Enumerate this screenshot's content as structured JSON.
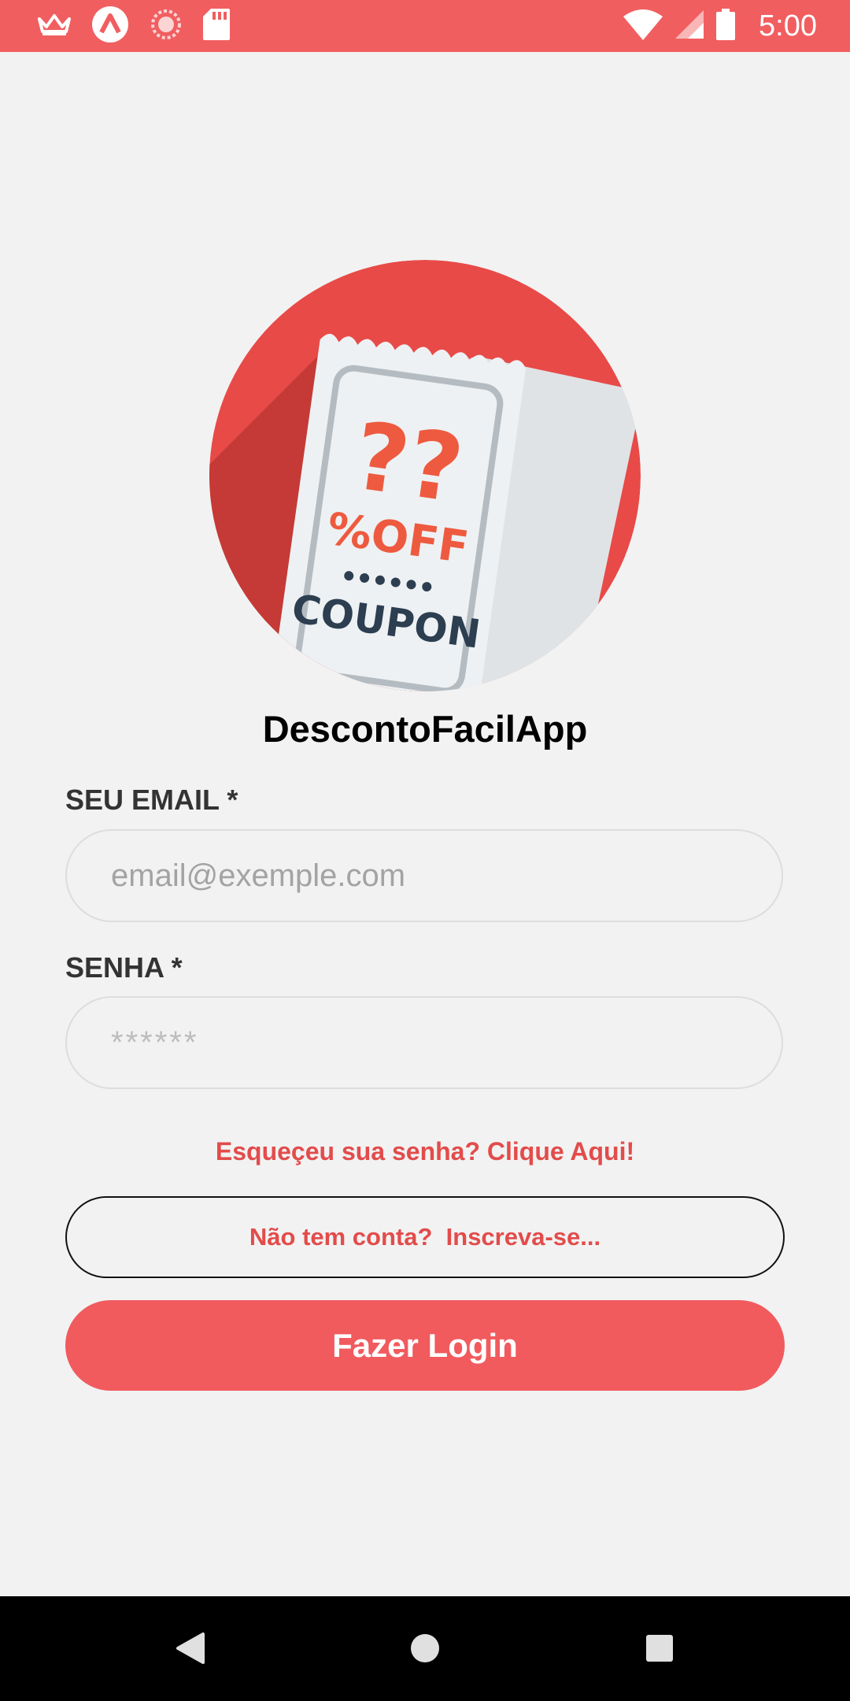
{
  "status_bar": {
    "time": "5:00",
    "icons_left": [
      "crown-icon",
      "app-logo-icon",
      "sync-icon",
      "sd-card-icon"
    ],
    "icons_right": [
      "wifi-icon",
      "signal-icon",
      "battery-icon"
    ],
    "color": "#f15e60"
  },
  "logo": {
    "question_marks": "??",
    "discount_text": "%OFF",
    "coupon_text": "COUPON",
    "circle_color": "#e84a48"
  },
  "app": {
    "title": "DescontoFacilApp"
  },
  "form": {
    "email_label": "SEU EMAIL *",
    "email_placeholder": "email@exemple.com",
    "email_value": "",
    "password_label": "SENHA *",
    "password_placeholder": "******",
    "password_value": "",
    "forgot_password": "Esqueçeu sua senha? Clique Aqui!",
    "signup": "Não tem conta?  Inscreva-se...",
    "login": "Fazer Login"
  },
  "colors": {
    "accent": "#f15b5e",
    "link": "#e24c4b",
    "background": "#f2f2f2"
  },
  "nav_bar": {
    "buttons": [
      "back-icon",
      "home-icon",
      "recents-icon"
    ]
  }
}
